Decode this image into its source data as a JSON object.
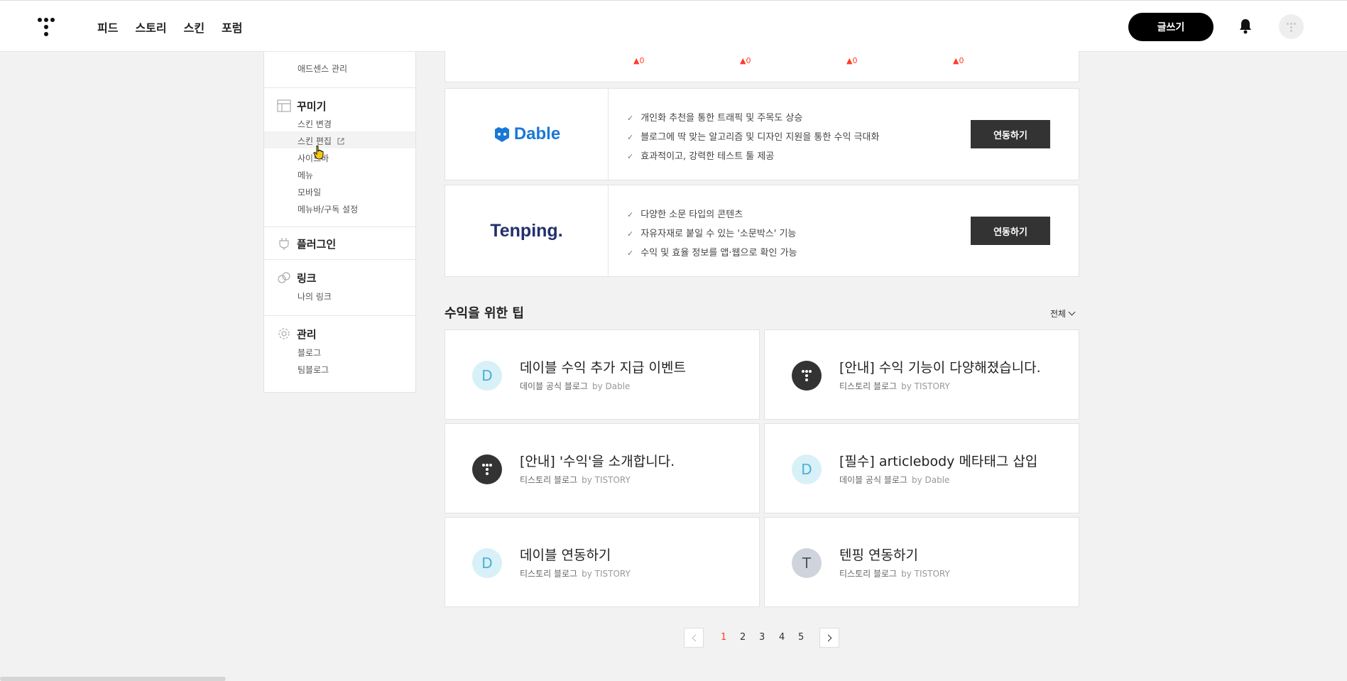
{
  "header": {
    "nav": [
      "피드",
      "스토리",
      "스킨",
      "포럼"
    ],
    "write_label": "글쓰기"
  },
  "sidebar": {
    "top_item": "애드센스 관리",
    "decorate": {
      "title": "꾸미기",
      "items": [
        "스킨 변경",
        "스킨 편집",
        "사이드바",
        "메뉴",
        "모바일",
        "메뉴바/구독 설정"
      ]
    },
    "plugin": {
      "title": "플러그인"
    },
    "link": {
      "title": "링크",
      "items": [
        "나의 링크"
      ]
    },
    "manage": {
      "title": "관리",
      "items": [
        "블로그",
        "팀블로그"
      ]
    }
  },
  "stats": [
    "0",
    "0",
    "0",
    "0"
  ],
  "partners": [
    {
      "name": "Dable",
      "features": [
        "개인화 추천을 통한 트래픽 및 주목도 상승",
        "블로그에 딱 맞는 알고리즘 및 디자인 지원을 통한 수익 극대화",
        "효과적이고, 강력한 테스트 툴 제공"
      ],
      "button": "연동하기"
    },
    {
      "name": "Tenping.",
      "features": [
        "다양한 소문 타입의 콘텐츠",
        "자유자재로 붙일 수 있는 '소문박스' 기능",
        "수익 및 효율 정보를 앱·웹으로 확인 가능"
      ],
      "button": "연동하기"
    }
  ],
  "tips": {
    "title": "수익을 위한 팁",
    "filter": "전체",
    "cards": [
      {
        "icon": "D",
        "title": "데이블 수익 추가 지급 이벤트",
        "source": "데이블 공식 블로그",
        "by": "by Dable"
      },
      {
        "icon": "",
        "title": "[안내] 수익 기능이 다양해졌습니다.",
        "source": "티스토리 블로그",
        "by": "by TISTORY"
      },
      {
        "icon": "",
        "title": "[안내] '수익'을 소개합니다.",
        "source": "티스토리 블로그",
        "by": "by TISTORY"
      },
      {
        "icon": "D",
        "title": "[필수] articlebody 메타태그 삽입",
        "source": "데이블 공식 블로그",
        "by": "by Dable"
      },
      {
        "icon": "D",
        "title": "데이블 연동하기",
        "source": "티스토리 블로그",
        "by": "by TISTORY"
      },
      {
        "icon": "T",
        "title": "텐핑 연동하기",
        "source": "티스토리 블로그",
        "by": "by TISTORY"
      }
    ]
  },
  "pagination": {
    "pages": [
      "1",
      "2",
      "3",
      "4",
      "5"
    ],
    "current": "1"
  },
  "colors": {
    "accent_red": "#ff3a2b",
    "dable_blue": "#1a78d6",
    "tenping_navy": "#22306b"
  }
}
